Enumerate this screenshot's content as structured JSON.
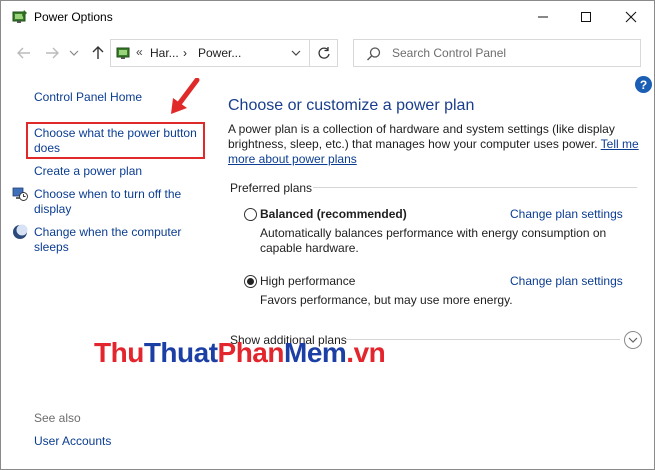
{
  "window": {
    "title": "Power Options",
    "controls": {
      "minimize": "—",
      "maximize": "□",
      "close": "✕"
    }
  },
  "address": {
    "sep": "«",
    "crumbs": [
      "Har...",
      "Power..."
    ],
    "crumb_sep": "›",
    "search_placeholder": "Search Control Panel"
  },
  "help_label": "?",
  "sidebar": {
    "home": "Control Panel Home",
    "items": [
      {
        "label": "Choose what the power button does",
        "icon": null
      },
      {
        "label": "Create a power plan",
        "icon": null
      },
      {
        "label": "Choose when to turn off the display",
        "icon": "monitor-clock-icon"
      },
      {
        "label": "Change when the computer sleeps",
        "icon": "moon-icon"
      }
    ],
    "see_also_label": "See also",
    "see_also_items": [
      "User Accounts"
    ]
  },
  "main": {
    "heading": "Choose or customize a power plan",
    "description": "A power plan is a collection of hardware and system settings (like display brightness, sleep, etc.) that manages how your computer uses power.",
    "description_link": "Tell me more about power plans",
    "preferred_label": "Preferred plans",
    "plans": [
      {
        "name": "Balanced (recommended)",
        "selected": false,
        "change_label": "Change plan settings",
        "desc": "Automatically balances performance with energy consumption on capable hardware."
      },
      {
        "name": "High performance",
        "selected": true,
        "change_label": "Change plan settings",
        "desc": "Favors performance, but may use more energy."
      }
    ],
    "show_additional": "Show additional plans"
  },
  "watermark": {
    "part1": "Thu",
    "part2": "Thuat",
    "part3": "Phan",
    "part4": "Mem",
    "part5": ".vn"
  },
  "colors": {
    "link": "#0b3d91",
    "heading": "#1a3e8c",
    "highlight": "#e02a2a"
  }
}
